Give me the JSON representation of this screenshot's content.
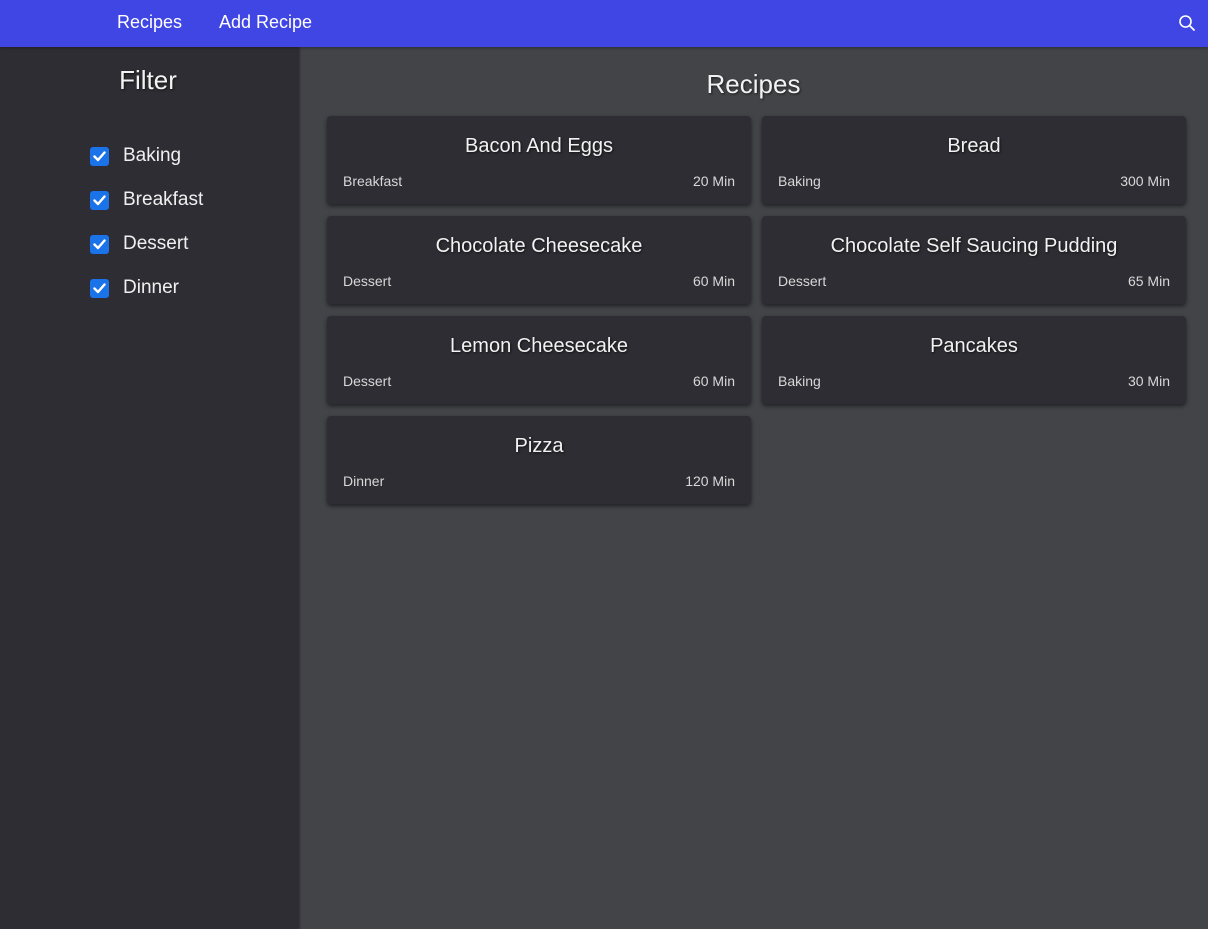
{
  "nav": {
    "recipes_label": "Recipes",
    "add_recipe_label": "Add Recipe",
    "search_icon": "search-icon"
  },
  "colors": {
    "topbar": "#3f46e3",
    "sidebar": "#2d2d33",
    "main_bg": "#424448",
    "card_bg": "#2d2d33",
    "checkbox": "#1a73e8"
  },
  "sidebar": {
    "title": "Filter",
    "filters": [
      {
        "label": "Baking",
        "checked": true
      },
      {
        "label": "Breakfast",
        "checked": true
      },
      {
        "label": "Dessert",
        "checked": true
      },
      {
        "label": "Dinner",
        "checked": true
      }
    ]
  },
  "main": {
    "title": "Recipes",
    "recipes": [
      {
        "name": "Bacon And Eggs",
        "category": "Breakfast",
        "time": "20 Min"
      },
      {
        "name": "Bread",
        "category": "Baking",
        "time": "300 Min"
      },
      {
        "name": "Chocolate Cheesecake",
        "category": "Dessert",
        "time": "60 Min"
      },
      {
        "name": "Chocolate Self Saucing Pudding",
        "category": "Dessert",
        "time": "65 Min"
      },
      {
        "name": "Lemon Cheesecake",
        "category": "Dessert",
        "time": "60 Min"
      },
      {
        "name": "Pancakes",
        "category": "Baking",
        "time": "30 Min"
      },
      {
        "name": "Pizza",
        "category": "Dinner",
        "time": "120 Min"
      }
    ]
  }
}
